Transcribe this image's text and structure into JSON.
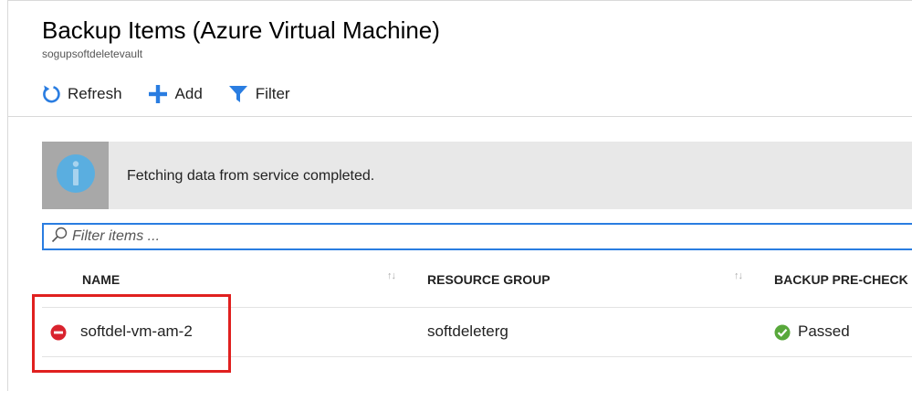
{
  "header": {
    "title": "Backup Items (Azure Virtual Machine)",
    "subtitle": "sogupsoftdeletevault"
  },
  "toolbar": {
    "refresh_label": "Refresh",
    "add_label": "Add",
    "filter_label": "Filter"
  },
  "info": {
    "message": "Fetching data from service completed."
  },
  "search": {
    "placeholder": "Filter items ..."
  },
  "table": {
    "columns": [
      "NAME",
      "RESOURCE GROUP",
      "BACKUP PRE-CHECK"
    ],
    "rows": [
      {
        "name": "softdel-vm-am-2",
        "resource_group": "softdeleterg",
        "backup_pre_check": "Passed",
        "name_status": "deleted",
        "precheck_status": "success"
      }
    ]
  },
  "colors": {
    "accent": "#2a7de1",
    "error": "#d9232e",
    "success": "#58a83b",
    "highlight": "#e0201f",
    "info_icon": "#5aaee0"
  },
  "icons": {
    "refresh": "refresh-icon",
    "add": "plus-icon",
    "filter": "funnel-icon",
    "info": "info-icon",
    "search": "search-icon",
    "row_status": "minus-circle-icon",
    "precheck_status": "check-circle-icon",
    "sort": "sort-arrows-icon"
  }
}
